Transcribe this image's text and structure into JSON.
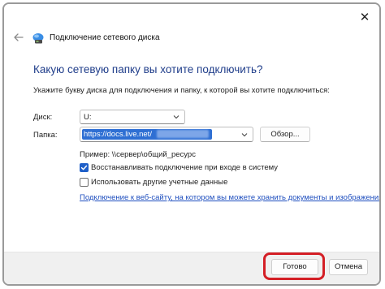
{
  "window": {
    "title": "Подключение сетевого диска",
    "close_glyph": "✕"
  },
  "main": {
    "heading": "Какую сетевую папку вы хотите подключить?",
    "instruction": "Укажите букву диска для подключения и папку, к которой вы хотите подключиться:"
  },
  "drive": {
    "label": "Диск:",
    "value": "U:"
  },
  "folder": {
    "label": "Папка:",
    "value": "https://docs.live.net/",
    "browse_label": "Обзор..."
  },
  "example_text": "Пример: \\\\сервер\\общий_ресурс",
  "options": {
    "reconnect": {
      "label": "Восстанавливать подключение при входе в систему",
      "checked": true
    },
    "other_credentials": {
      "label": "Использовать другие учетные данные",
      "checked": false
    }
  },
  "link_text": "Подключение к веб-сайту, на котором вы можете хранить документы и изображения.",
  "footer": {
    "done_label": "Готово",
    "cancel_label": "Отмена"
  },
  "colors": {
    "accent": "#1f5fc8",
    "heading": "#1f3d8a",
    "highlight": "#d41f26"
  }
}
